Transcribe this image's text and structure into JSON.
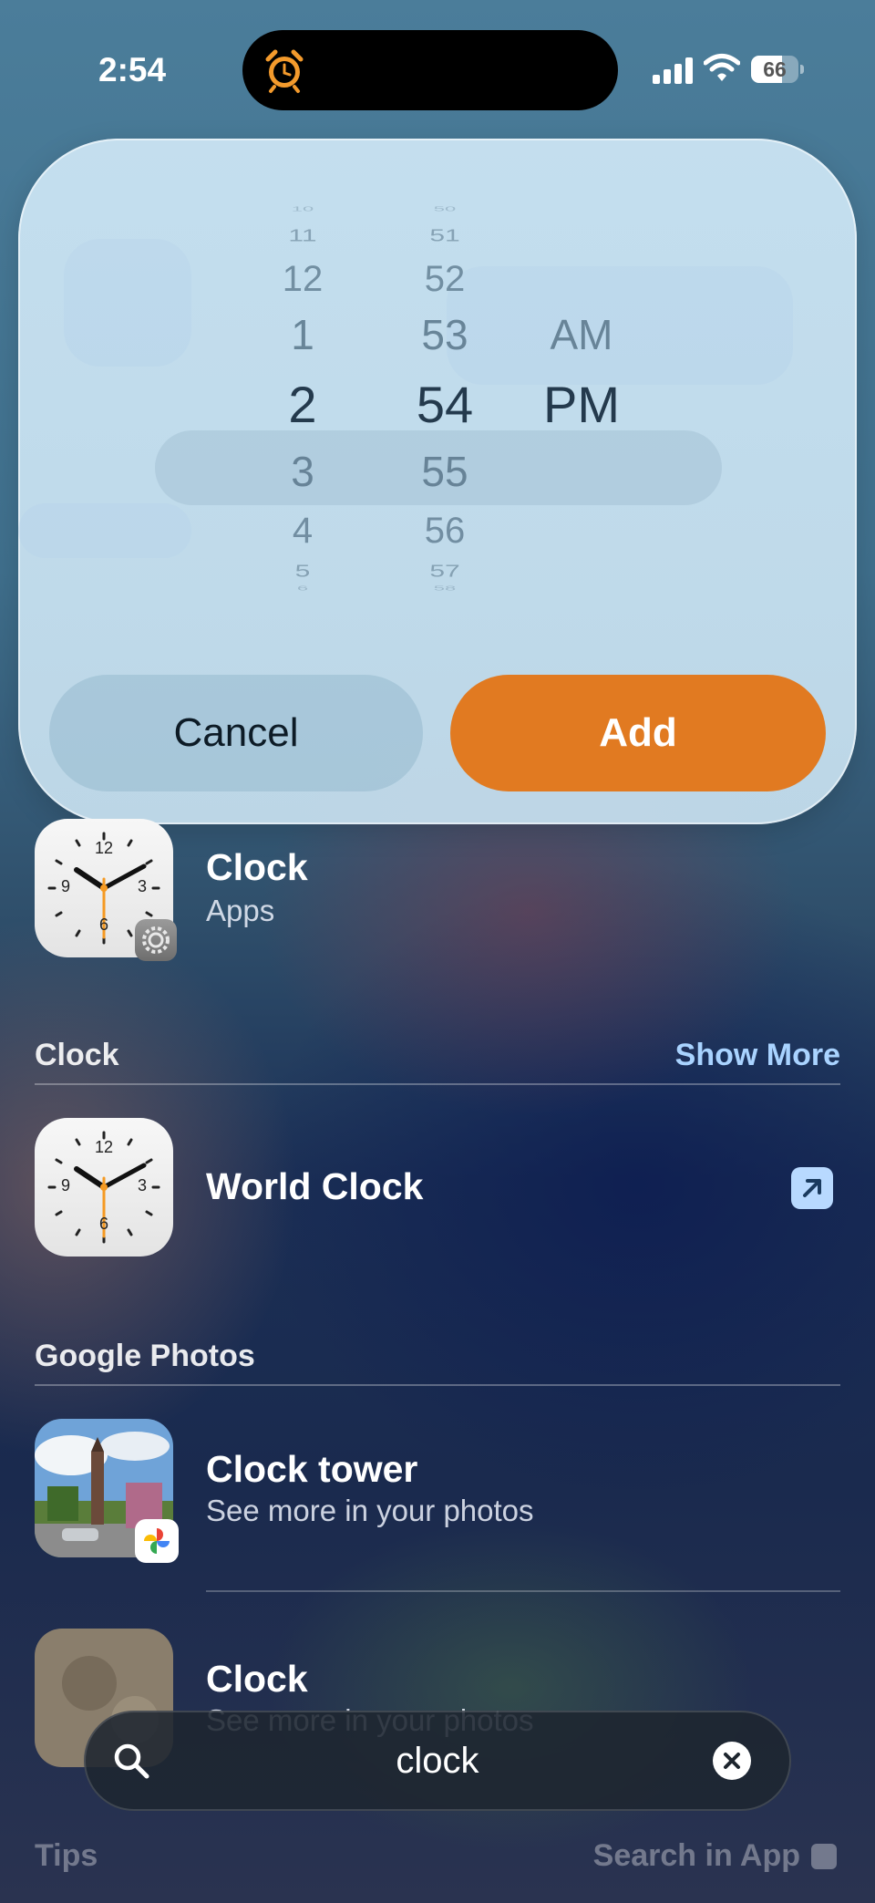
{
  "status_bar": {
    "time": "2:54",
    "battery_percent": "66",
    "battery_level": 0.66
  },
  "time_picker": {
    "hours": [
      "10",
      "11",
      "12",
      "1",
      "2",
      "3",
      "4",
      "5",
      "6"
    ],
    "minutes": [
      "50",
      "51",
      "52",
      "53",
      "54",
      "55",
      "56",
      "57",
      "58"
    ],
    "ampm": [
      "AM",
      "PM"
    ],
    "selected_hour": "2",
    "selected_minute": "54",
    "selected_ampm": "PM",
    "cancel_label": "Cancel",
    "add_label": "Add",
    "accent_color": "#e17a21"
  },
  "app_result": {
    "title": "Clock",
    "subtitle": "Apps"
  },
  "clock_section": {
    "header": "Clock",
    "show_more": "Show More",
    "item_title": "World Clock"
  },
  "photos_section": {
    "header": "Google Photos",
    "items": [
      {
        "title": "Clock tower",
        "subtitle": "See more in your photos"
      },
      {
        "title": "Clock",
        "subtitle": "See more in your photos"
      }
    ]
  },
  "search": {
    "query": "clock"
  },
  "bottom": {
    "tips_label": "Tips",
    "search_in_app_label": "Search in App"
  },
  "clock_face_numbers": [
    "12",
    "3",
    "6",
    "9"
  ]
}
